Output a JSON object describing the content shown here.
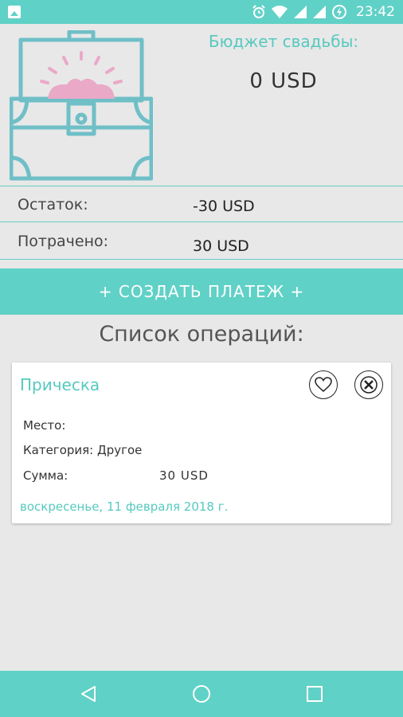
{
  "status_bar": {
    "time": "23:42",
    "icons": [
      "image-notification-icon",
      "alarm-icon",
      "wifi-icon",
      "signal-icon",
      "signal-icon",
      "battery-charging-icon"
    ]
  },
  "header": {
    "budget_title": "Бюджет свадьбы:",
    "budget_value": "0 USD"
  },
  "summary": {
    "remaining_label": "Остаток:",
    "remaining_value": "-30 USD",
    "spent_label": "Потрачено:",
    "spent_value": "30 USD"
  },
  "actions": {
    "create_payment": "+ СОЗДАТЬ ПЛАТЕЖ +"
  },
  "operations": {
    "title": "Список операций:",
    "items": [
      {
        "name": "Прическа",
        "place_label": "Место:",
        "category_text": "Категория: Другое",
        "sum_label": "Сумма:",
        "sum_value": "30 USD",
        "date": "воскресенье, 11 февраля 2018 г."
      }
    ]
  },
  "colors": {
    "accent": "#60d1c6",
    "accent_text": "#56c9bf",
    "chest_pink": "#eaa9c7",
    "background": "#e8e8e8"
  }
}
